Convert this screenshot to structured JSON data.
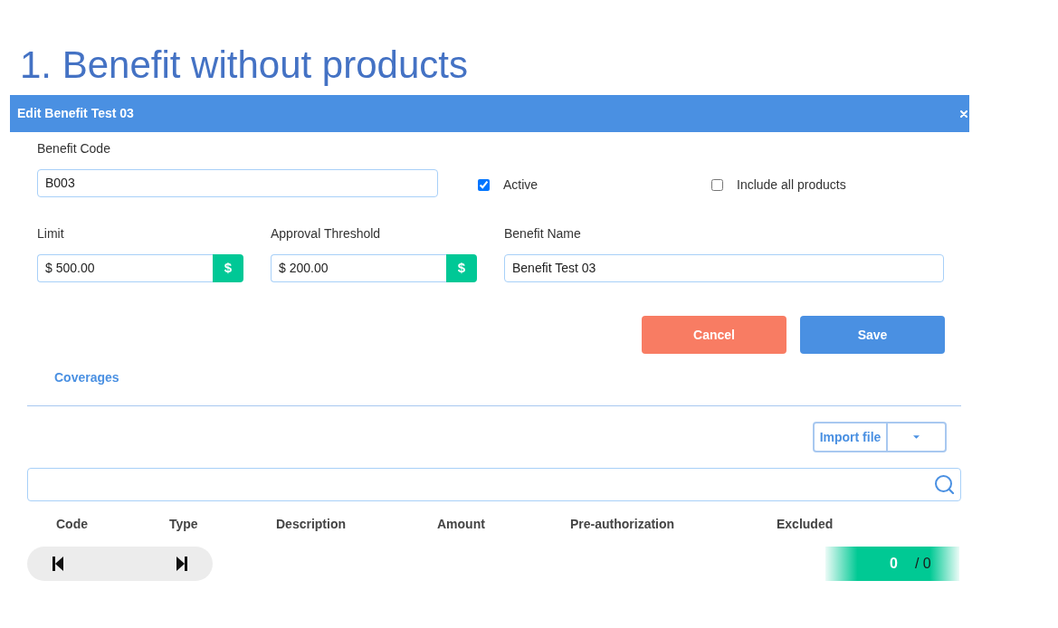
{
  "slide_title": "1. Benefit without products",
  "dialog": {
    "title": "Edit Benefit Test 03",
    "benefit_code": {
      "label": "Benefit Code",
      "value": "B003"
    },
    "checkboxes": [
      {
        "label": "Active",
        "checked": true
      },
      {
        "label": "Include all products",
        "checked": false
      }
    ],
    "amount_fields": [
      {
        "label": "Limit",
        "value": "$ 500.00",
        "addon": "$"
      },
      {
        "label": "Approval Threshold",
        "value": "$ 200.00",
        "addon": "$"
      }
    ],
    "benefit_name": {
      "label": "Benefit Name",
      "value": "Benefit Test 03"
    },
    "buttons": [
      {
        "label": "Cancel",
        "kind": "cancel"
      },
      {
        "label": "Save",
        "kind": "save"
      }
    ],
    "tabs": [
      {
        "label": "Coverages",
        "selected": true
      }
    ],
    "import_button": {
      "label": "Import file"
    },
    "table": {
      "columns": [
        "Code",
        "Type",
        "Description",
        "Amount",
        "Pre-authorization",
        "Excluded"
      ]
    },
    "pager": {
      "current": "0",
      "total": "/ 0"
    }
  }
}
